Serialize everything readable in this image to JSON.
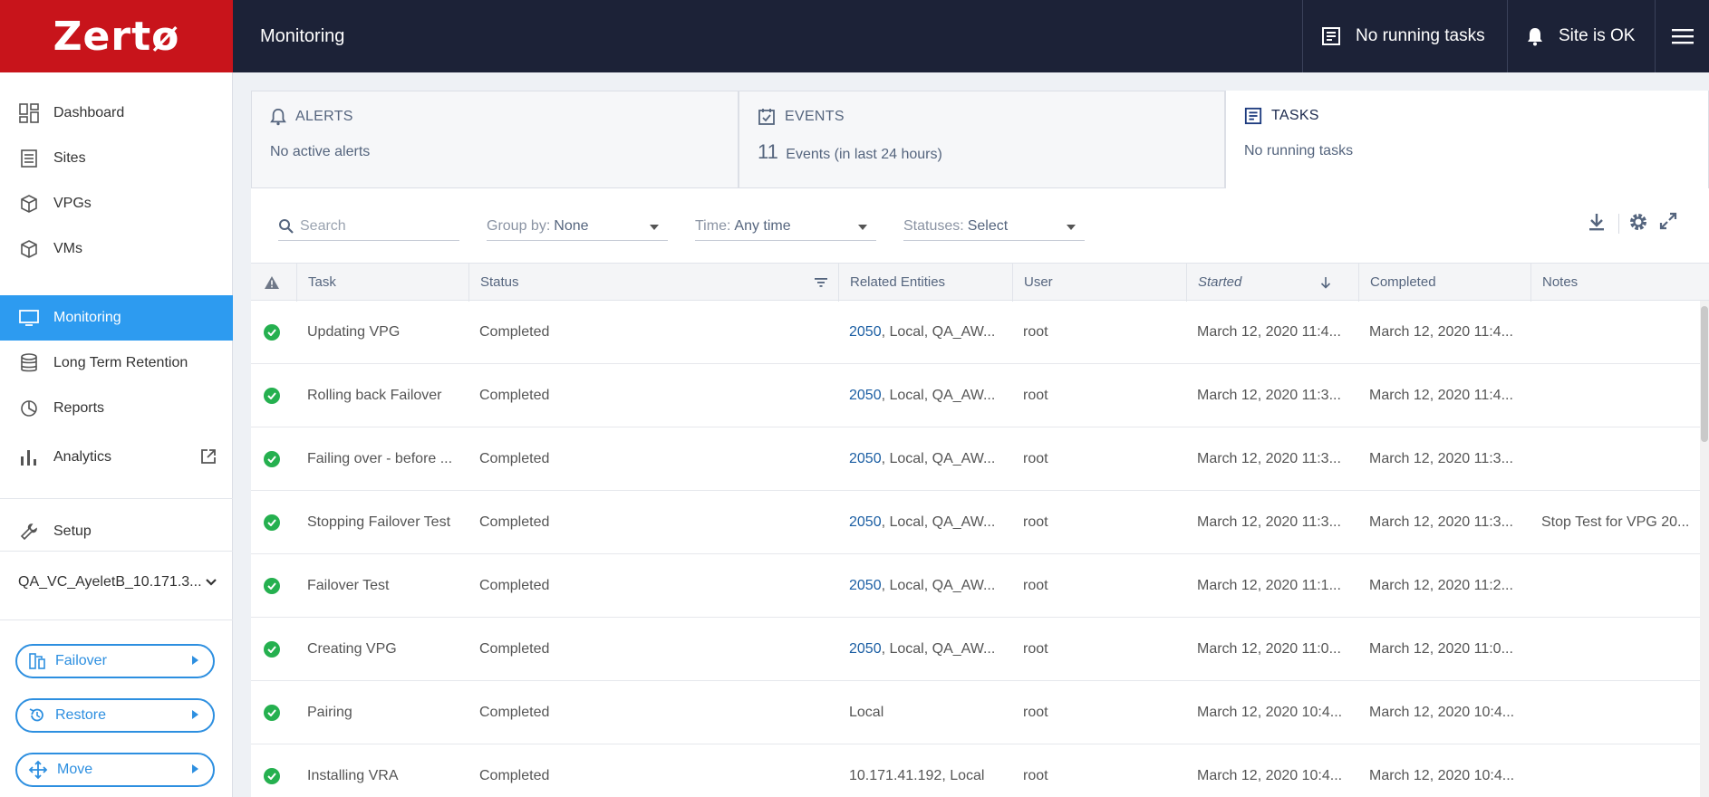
{
  "app": {
    "logo": "Zertø",
    "page_title": "Monitoring"
  },
  "topbar": {
    "tasks_status": "No running tasks",
    "site_status": "Site is OK"
  },
  "sidebar": {
    "items": [
      {
        "label": "Dashboard",
        "icon": "dashboard-icon"
      },
      {
        "label": "Sites",
        "icon": "sites-icon"
      },
      {
        "label": "VPGs",
        "icon": "vpgs-icon"
      },
      {
        "label": "VMs",
        "icon": "vms-icon"
      },
      {
        "label": "Monitoring",
        "icon": "monitor-icon",
        "active": true
      },
      {
        "label": "Long Term Retention",
        "icon": "database-icon"
      },
      {
        "label": "Reports",
        "icon": "pie-chart-icon"
      },
      {
        "label": "Analytics",
        "icon": "bar-chart-icon"
      },
      {
        "label": "Setup",
        "icon": "wrench-icon"
      }
    ],
    "site_selector": "QA_VC_AyeletB_10.171.3...",
    "actions": [
      {
        "label": "Failover",
        "icon": "failover-icon"
      },
      {
        "label": "Restore",
        "icon": "restore-icon"
      },
      {
        "label": "Move",
        "icon": "move-icon"
      }
    ]
  },
  "panels": {
    "alerts": {
      "title": "ALERTS",
      "text": "No active alerts"
    },
    "events": {
      "title": "EVENTS",
      "count": "11",
      "text": "Events (in last 24 hours)"
    },
    "tasks": {
      "title": "TASKS",
      "text": "No running tasks"
    }
  },
  "filters": {
    "search_placeholder": "Search",
    "group_by": {
      "label": "Group by:",
      "value": "None"
    },
    "time": {
      "label": "Time:",
      "value": "Any time"
    },
    "statuses": {
      "label": "Statuses:",
      "value": "Select"
    }
  },
  "table": {
    "columns": [
      "Task",
      "Status",
      "Related Entities",
      "User",
      "Started",
      "Completed",
      "Notes"
    ],
    "rows": [
      {
        "task": "Updating VPG",
        "status": "Completed",
        "entity_link": "2050",
        "entity_rest": ", Local, QA_AW...",
        "user": "root",
        "started": "March 12, 2020 11:4...",
        "completed": "March 12, 2020 11:4...",
        "notes": ""
      },
      {
        "task": "Rolling back Failover",
        "status": "Completed",
        "entity_link": "2050",
        "entity_rest": ", Local, QA_AW...",
        "user": "root",
        "started": "March 12, 2020 11:3...",
        "completed": "March 12, 2020 11:4...",
        "notes": ""
      },
      {
        "task": "Failing over - before ...",
        "status": "Completed",
        "entity_link": "2050",
        "entity_rest": ", Local, QA_AW...",
        "user": "root",
        "started": "March 12, 2020 11:3...",
        "completed": "March 12, 2020 11:3...",
        "notes": ""
      },
      {
        "task": "Stopping Failover Test",
        "status": "Completed",
        "entity_link": "2050",
        "entity_rest": ", Local, QA_AW...",
        "user": "root",
        "started": "March 12, 2020 11:3...",
        "completed": "March 12, 2020 11:3...",
        "notes": "Stop Test for VPG 20..."
      },
      {
        "task": "Failover Test",
        "status": "Completed",
        "entity_link": "2050",
        "entity_rest": ", Local, QA_AW...",
        "user": "root",
        "started": "March 12, 2020 11:1...",
        "completed": "March 12, 2020 11:2...",
        "notes": ""
      },
      {
        "task": "Creating VPG",
        "status": "Completed",
        "entity_link": "2050",
        "entity_rest": ", Local, QA_AW...",
        "user": "root",
        "started": "March 12, 2020 11:0...",
        "completed": "March 12, 2020 11:0...",
        "notes": ""
      },
      {
        "task": "Pairing",
        "status": "Completed",
        "entity_link": "",
        "entity_rest": "Local",
        "user": "root",
        "started": "March 12, 2020 10:4...",
        "completed": "March 12, 2020 10:4...",
        "notes": ""
      },
      {
        "task": "Installing VRA",
        "status": "Completed",
        "entity_link": "",
        "entity_rest": "10.171.41.192, Local",
        "user": "root",
        "started": "March 12, 2020 10:4...",
        "completed": "March 12, 2020 10:4...",
        "notes": ""
      }
    ]
  },
  "colors": {
    "brand": "#c8141b",
    "topbar": "#1c2237",
    "accent": "#2d9bf0",
    "success": "#25b04f"
  }
}
